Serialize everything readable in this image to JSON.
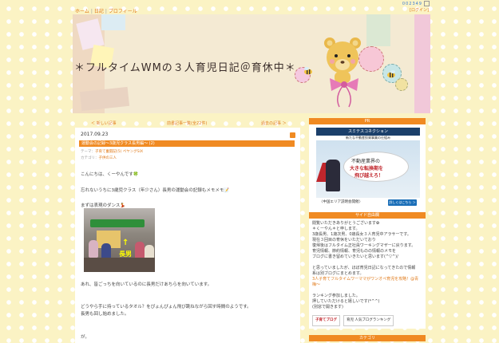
{
  "top_nav": {
    "home": "ホーム",
    "diary": "日記",
    "profile": "プロフィール"
  },
  "counter": "002349",
  "login": "[ログイン]",
  "blog_title": "＊フルタイムWMの３人育児日記＠育休中＊",
  "pager": {
    "newer": "＜ 新しい記事",
    "list": "前書記事一覧(全22件)",
    "older": "過去の記事 ＞"
  },
  "article": {
    "date": "2017.09.23",
    "title": "運動会の記録〜3歳児クラス長男編〜 (2)",
    "theme_label": "テーマ：",
    "theme": "子育て奮闘記(5) ペヤングSIX",
    "category_label": "カテゴリ：",
    "category": "子供の三人",
    "lines": [
      "こんにちは、くーやんです🍀",
      "忘れないうちに3歳児クラス（年少さん）長男の運動会の記録もメモメモ📝",
      "まずは表現のダンス💃",
      "あれ、皆ごっちを向いているのに長男だけあちらを向いています。",
      "どうやら手に持っているタオル？をぴょんぴょん飛び跳ねながら回す時間のようです。",
      "長男も回し始めました。",
      "が。"
    ],
    "photo_label": "長男"
  },
  "sidebar": {
    "pr_head": "PR",
    "ad": {
      "header": "スミテスコネクション",
      "sub": "新たな不動産投資事業の仕組み",
      "line1": "不動産業界の",
      "line2": "大きな転換期を",
      "line3": "飛び越えろ！",
      "footer": "〈中国エリア説明会開催〉",
      "button": "詳しくはこちら ＞"
    },
    "free_head": "サイド自由欄",
    "free_lines": [
      "閲覧いただきありがとうございます✿",
      "＊くーやん＊と申します。",
      "3歳長男、1歳次男、0歳長女３人育児中アラサーです。",
      "現在３回目の育休をいただいており",
      "復帰後はフルタイム正社員ワーキングマザーに戻ります。",
      "育児情報、節約情報、育児ものの情報のメモを",
      "ブログに書き留めていきたいと思います(^▽^)/"
    ],
    "free_lines2": [
      "と思っていましたが、ほぼ育児日記になってきたので情報",
      "系は別ブログにまとめます。"
    ],
    "free_link": "3人子育てフルタイムワーママがワンオペ育児を攻略！@青梅〜",
    "free_lines3": [
      "ランキング参加しました。",
      "押していただけると嬉しいです(*^^)",
      "(別窓で開きます)"
    ],
    "btn1": "子育てブログ",
    "btn2": "育児 人気ブログランキング",
    "cat_head": "カテゴリ"
  }
}
